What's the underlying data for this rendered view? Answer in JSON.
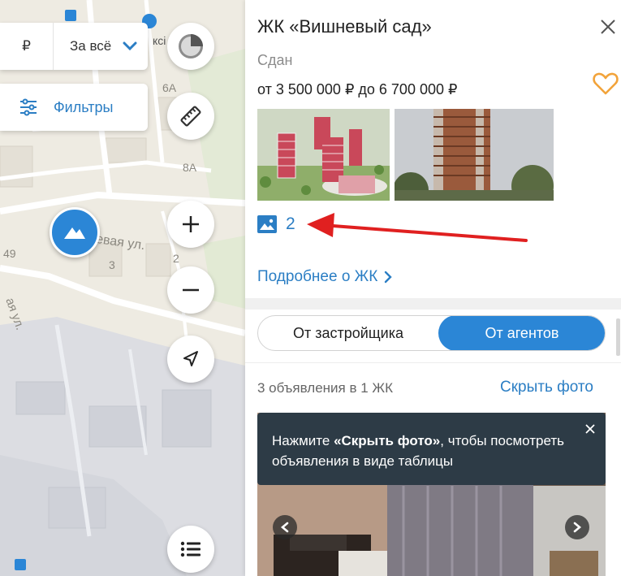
{
  "map": {
    "price_currency": "₽",
    "price_period": "За всё",
    "filters_label": "Фильтры",
    "labels": {
      "house_6a": "6А",
      "house_8a": "8А",
      "house_2": "2",
      "house_3": "3",
      "house_49": "49",
      "street_1": "евая ул.",
      "street_2": "ая ул.",
      "poi": "ксі"
    },
    "icons": {
      "layers": "layers-icon",
      "ruler": "ruler-icon",
      "zoom_in": "plus-icon",
      "zoom_out": "minus-icon",
      "locate": "navigation-arrow-icon",
      "list": "list-icon",
      "marker": "building-marker-icon"
    }
  },
  "panel": {
    "title": "ЖК «Вишневый сад»",
    "status": "Сдан",
    "price_range": "от 3 500 000 ₽ до 6 700 000 ₽",
    "photo_count": "2",
    "more_link": "Подробнее о ЖК",
    "toggle": {
      "developer": "От застройщика",
      "agents": "От агентов",
      "selected": "agents"
    },
    "listings_count": "3 объявления в 1 ЖК",
    "hide_photos": "Скрыть фото",
    "tooltip": {
      "prefix": "Нажмите ",
      "bold": "«Скрыть фото»",
      "suffix": ", чтобы посмотреть объявления в виде таблицы"
    }
  },
  "colors": {
    "accent": "#2b86d6",
    "link": "#2b7ec4",
    "favorite": "#f2a33a",
    "tooltip_bg": "#2d3b46",
    "annotation": "#e02020"
  }
}
